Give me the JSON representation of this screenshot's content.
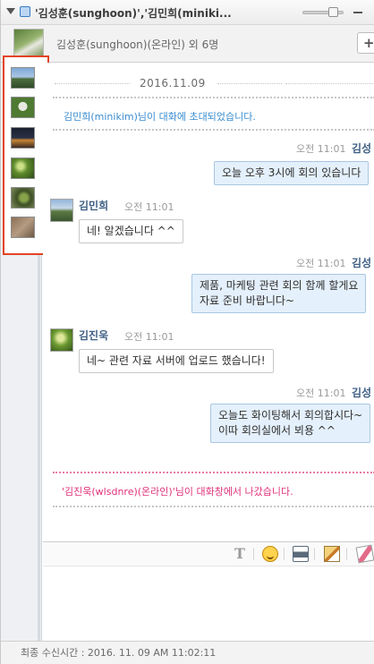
{
  "window": {
    "title": "'김성훈(sunghoon)','김민희(miniki..."
  },
  "header": {
    "participants": "김성훈(sunghoon)(온라인) 외 6명",
    "add_label": "+"
  },
  "sidebar": {
    "photos": [
      "photo-lake",
      "photo-goat",
      "photo-night-city",
      "photo-leaves",
      "photo-peacock",
      "photo-texture"
    ]
  },
  "chat": {
    "date": "2016.11.09",
    "notice_invite": "김민희(minikim)님이 대화에 초대되었습니다.",
    "messages": [
      {
        "direction": "out",
        "time": "오전 11:01",
        "sender": "김성",
        "text": "오늘 오후 3시에 회의 있습니다"
      },
      {
        "direction": "in",
        "time": "오전 11:01",
        "sender": "김민희",
        "text": "네! 알겠습니다 ^^"
      },
      {
        "direction": "out",
        "time": "오전 11:01",
        "sender": "김성",
        "lines": [
          "제품, 마케팅 관련 회의 함께 할게요",
          "자료 준비 바랍니다~"
        ]
      },
      {
        "direction": "in",
        "time": "오전 11:01",
        "sender": "김진욱",
        "text": "네~ 관련 자료 서버에 업로드 했습니다!"
      },
      {
        "direction": "out",
        "time": "오전 11:01",
        "sender": "김성",
        "lines": [
          "오늘도 화이팅해서 회의합시다~",
          "이따 회의실에서 뵈용 ^^"
        ]
      }
    ],
    "notice_leave": "'김진욱(wlsdnre)(온라인)'님이 대화창에서 나갔습니다."
  },
  "toolbar": {
    "font_label": "T",
    "icons": [
      "font-icon",
      "emoji-icon",
      "print-icon",
      "file-icon",
      "eraser-icon"
    ]
  },
  "status": {
    "last_received": "최종 수신시간 : 2016. 11. 09 AM 11:02:11"
  },
  "colors": {
    "outgoing_bubble": "#e4f0fb",
    "invite_notice": "#3a8cd0",
    "leave_notice": "#e0307a",
    "photo_panel_border": "#e24424"
  }
}
